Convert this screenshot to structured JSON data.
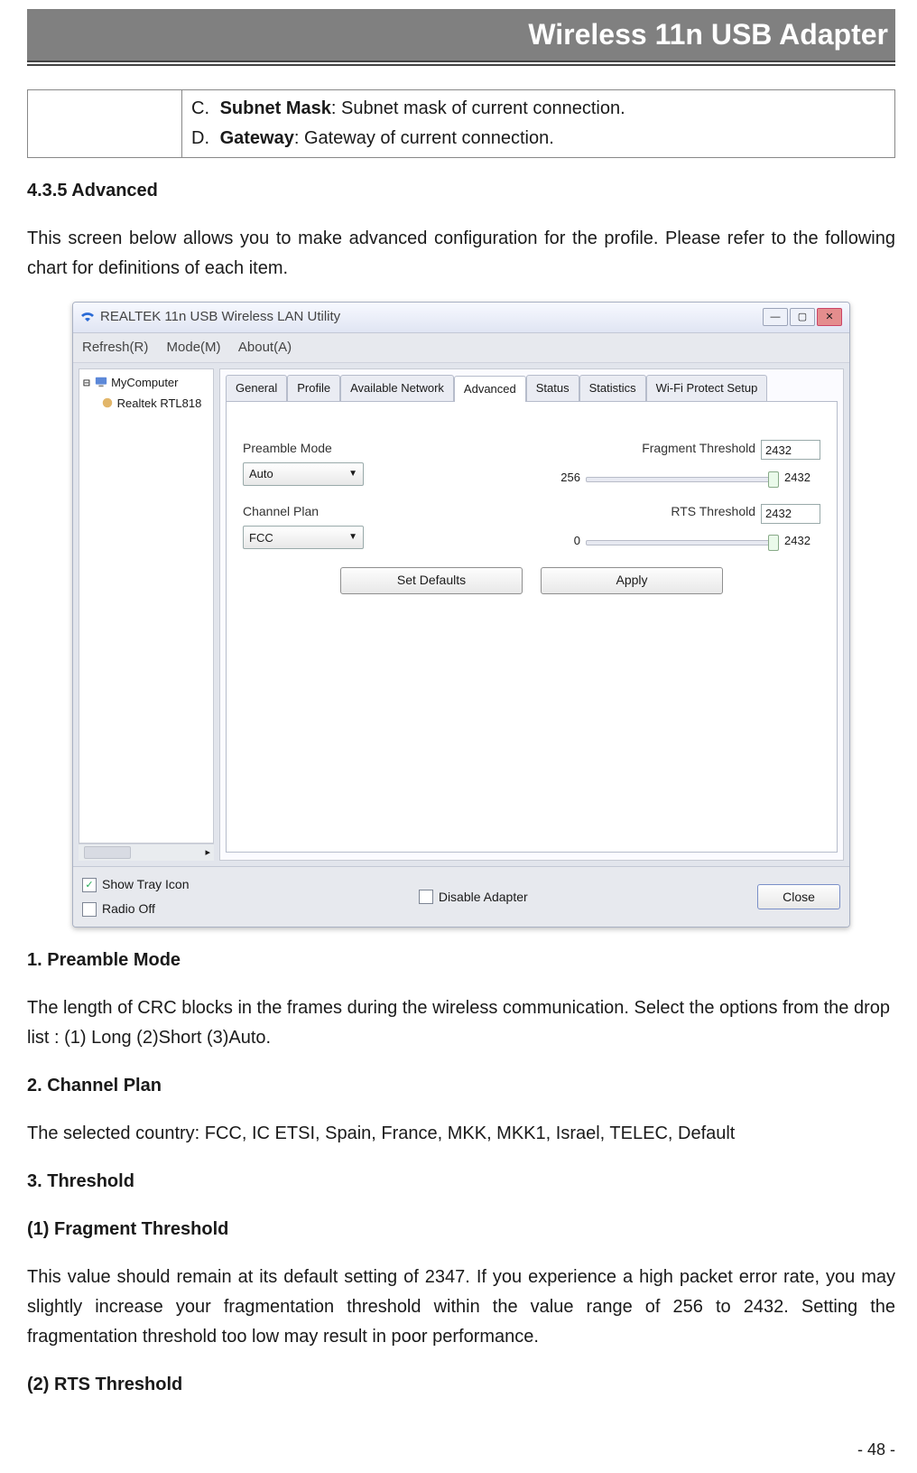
{
  "header_title": "Wireless 11n USB Adapter",
  "tbl": {
    "c_letter": "C.",
    "c_bold": "Subnet Mask",
    "c_rest": ": Subnet mask of current connection.",
    "d_letter": "D.",
    "d_bold": "Gateway",
    "d_rest": ": Gateway of current connection."
  },
  "sec435": "4.3.5  Advanced",
  "para435": "This screen below allows you to make advanced configuration for the profile. Please refer to the following chart for definitions of each item.",
  "win": {
    "title": "REALTEK 11n USB Wireless LAN Utility",
    "menus": [
      "Refresh(R)",
      "Mode(M)",
      "About(A)"
    ],
    "tree": {
      "root": "MyComputer",
      "child": "Realtek RTL818"
    },
    "tabs": [
      "General",
      "Profile",
      "Available Network",
      "Advanced",
      "Status",
      "Statistics",
      "Wi-Fi Protect Setup"
    ],
    "preamble_lbl": "Preamble Mode",
    "preamble_val": "Auto",
    "chplan_lbl": "Channel Plan",
    "chplan_val": "FCC",
    "frag_lbl": "Fragment Threshold",
    "frag_val": "2432",
    "frag_min": "256",
    "frag_max": "2432",
    "rts_lbl": "RTS Threshold",
    "rts_val": "2432",
    "rts_min": "0",
    "rts_max": "2432",
    "btn_defaults": "Set Defaults",
    "btn_apply": "Apply",
    "chk_tray": "Show Tray Icon",
    "chk_radio": "Radio Off",
    "chk_disable": "Disable Adapter",
    "btn_close": "Close"
  },
  "h1": "1. Preamble Mode",
  "p1": "The length of CRC blocks in the frames during the wireless communication. Select the options from the drop list : (1) Long  (2)Short  (3)Auto.",
  "h2": "2. Channel Plan",
  "p2": "The selected country: FCC, IC ETSI, Spain, France, MKK, MKK1, Israel, TELEC, Default",
  "h3": "3. Threshold",
  "h31": "(1) Fragment Threshold",
  "p31": "This value should remain at its default setting of 2347. If you experience a high packet error rate, you may slightly increase your fragmentation threshold within the value range of 256 to 2432. Setting the fragmentation threshold too low may result in poor performance.",
  "h32": "(2) RTS Threshold",
  "page": "- 48 -"
}
